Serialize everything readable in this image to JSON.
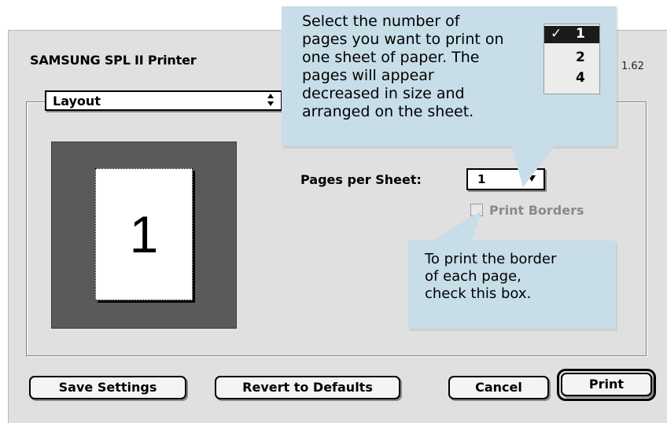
{
  "dialog": {
    "printer_name": "SAMSUNG SPL II Printer",
    "version": "1.62",
    "panel_popup": {
      "label": "Layout",
      "arrows": "⬍"
    }
  },
  "preview": {
    "page_number": "1"
  },
  "pages_per_sheet": {
    "label": "Pages per Sheet:",
    "value": "1",
    "options": [
      "1",
      "2",
      "4"
    ],
    "checkmark": "✓"
  },
  "print_borders": {
    "label": "Print Borders",
    "checked": false,
    "enabled": false
  },
  "callouts": {
    "top": "Select the number of\npages you want to print on\none sheet of paper. The\npages will appear\ndecreased in size and\narranged on the sheet.",
    "bottom": "To print the border\nof each page,\ncheck this box."
  },
  "buttons": {
    "save_settings": "Save Settings",
    "revert": "Revert to Defaults",
    "cancel": "Cancel",
    "print": "Print"
  },
  "colors": {
    "callout_bg": "#c7dde8",
    "dialog_bg": "#e0e0e0",
    "preview_bg": "#5a5a5a"
  }
}
